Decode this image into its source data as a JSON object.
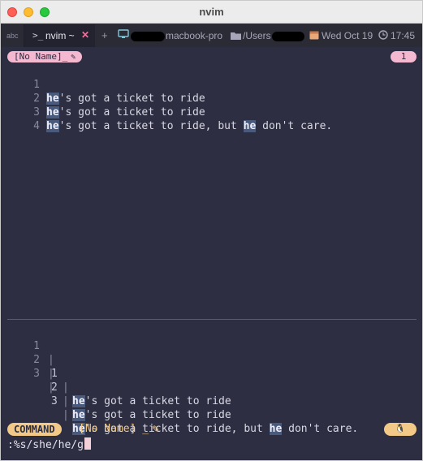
{
  "window": {
    "title": "nvim"
  },
  "tabbar": {
    "input_indicator": "abc",
    "prompt_glyph": ">_",
    "active_tab": "nvim ~",
    "close_glyph": "✕",
    "new_tab_glyph": "+",
    "host": "macbook-pro",
    "path": "/Users",
    "date": "Wed Oct 19",
    "time": "17:45"
  },
  "buffer": {
    "name": "[No Name]_",
    "tab_number": "1",
    "lines": [
      {
        "num": "1",
        "match": "he",
        "rest": "'s got a ticket to ride",
        "match2": "",
        "rest2": ""
      },
      {
        "num": "2",
        "match": "he",
        "rest": "'s got a ticket to ride",
        "match2": "",
        "rest2": ""
      },
      {
        "num": "3",
        "match": "he",
        "rest": "'s got a ticket to ride, but ",
        "match2": "he",
        "rest2": " don't care."
      },
      {
        "num": "4",
        "match": "",
        "rest": "",
        "match2": "",
        "rest2": ""
      }
    ]
  },
  "preview": {
    "lines": [
      {
        "num": "1",
        "idx": "1",
        "match": "he",
        "rest": "'s got a ticket to ride",
        "match2": "",
        "rest2": ""
      },
      {
        "num": "2",
        "idx": "2",
        "match": "he",
        "rest": "'s got a ticket to ride",
        "match2": "",
        "rest2": ""
      },
      {
        "num": "3",
        "idx": "3",
        "match": "he",
        "rest": "'s got a ticket to ride, but ",
        "match2": "he",
        "rest2": " don't care."
      }
    ]
  },
  "statusline": {
    "mode": "COMMAND",
    "file": "[No Name]  _",
    "os_glyph": "🐧"
  },
  "cmdline": {
    "text": ":%s/she/he/g"
  },
  "colors": {
    "background": "#2e2e42",
    "buffer_pill": "#f4b8d0",
    "mode_pill": "#f2c987",
    "search_highlight": "#4a5a7c",
    "close_accent": "#ff6b9a"
  }
}
